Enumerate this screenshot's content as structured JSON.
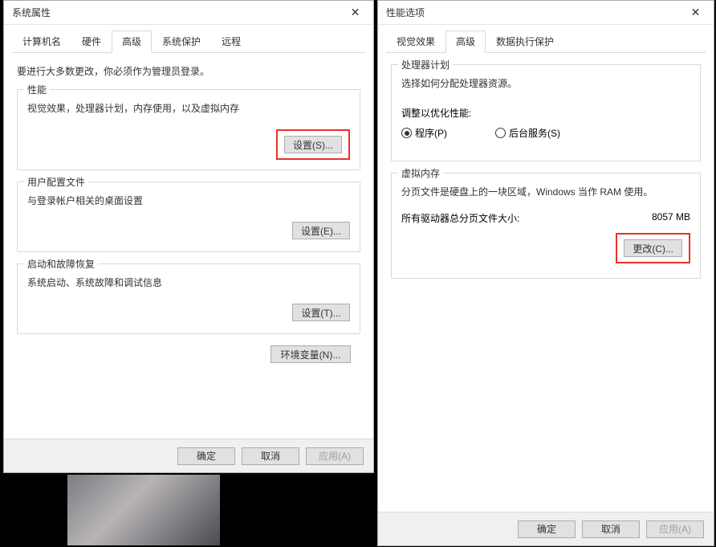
{
  "left": {
    "title": "系统属性",
    "tabs": [
      "计算机名",
      "硬件",
      "高级",
      "系统保护",
      "远程"
    ],
    "active_tab": 2,
    "note": "要进行大多数更改，你必须作为管理员登录。",
    "groups": {
      "performance": {
        "title": "性能",
        "desc": "视觉效果，处理器计划，内存使用，以及虚拟内存",
        "button": "设置(S)..."
      },
      "userprofile": {
        "title": "用户配置文件",
        "desc": "与登录帐户相关的桌面设置",
        "button": "设置(E)..."
      },
      "startup": {
        "title": "启动和故障恢复",
        "desc": "系统启动、系统故障和调试信息",
        "button": "设置(T)..."
      }
    },
    "env_button": "环境变量(N)...",
    "buttons": {
      "ok": "确定",
      "cancel": "取消",
      "apply": "应用(A)"
    }
  },
  "right": {
    "title": "性能选项",
    "tabs": [
      "视觉效果",
      "高级",
      "数据执行保护"
    ],
    "active_tab": 1,
    "groups": {
      "scheduling": {
        "title": "处理器计划",
        "desc": "选择如何分配处理器资源。",
        "adjust_label": "调整以优化性能:",
        "radio_programs": "程序(P)",
        "radio_services": "后台服务(S)"
      },
      "vm": {
        "title": "虚拟内存",
        "desc": "分页文件是硬盘上的一块区域，Windows 当作 RAM 使用。",
        "total_label": "所有驱动器总分页文件大小:",
        "total_value": "8057 MB",
        "button": "更改(C)..."
      }
    },
    "buttons": {
      "ok": "确定",
      "cancel": "取消",
      "apply": "应用(A)"
    }
  }
}
